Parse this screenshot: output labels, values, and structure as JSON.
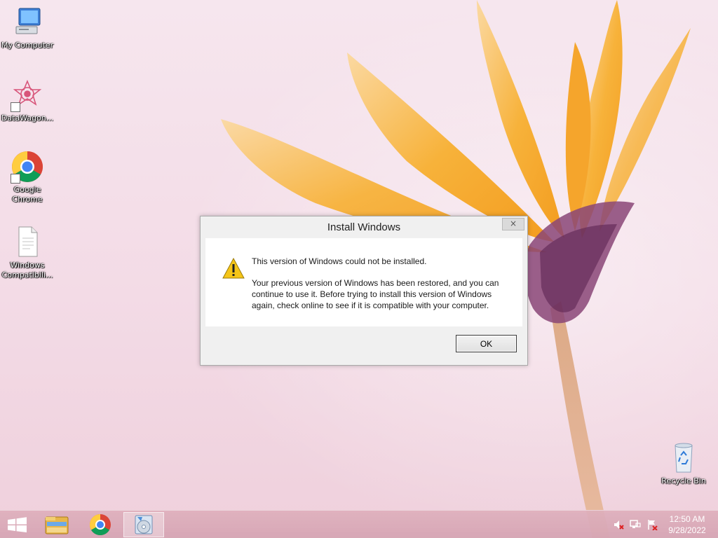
{
  "desktop": {
    "icons": [
      {
        "label": "My Computer",
        "icon": "computer-icon"
      },
      {
        "label": "DataWagon...",
        "icon": "datawagon-icon"
      },
      {
        "label": "Google Chrome",
        "icon": "chrome-icon"
      },
      {
        "label": "Windows Compatibili...",
        "icon": "document-icon"
      },
      {
        "label": "Recycle Bin",
        "icon": "recycle-bin-icon"
      }
    ]
  },
  "dialog": {
    "title": "Install Windows",
    "close_label": "×",
    "message_main": "This version of Windows could not be installed.",
    "message_detail": "Your previous version of Windows has been restored, and you can continue to use it.  Before trying to install this version of Windows again, check online to see if it is compatible with your computer.",
    "icon": "warning-icon",
    "ok_label": "OK"
  },
  "taskbar": {
    "buttons": [
      {
        "icon": "start-windows-icon"
      },
      {
        "icon": "file-explorer-icon"
      },
      {
        "icon": "chrome-icon"
      },
      {
        "icon": "setup-disc-icon",
        "active": true
      }
    ],
    "tray": [
      {
        "icon": "volume-muted-icon"
      },
      {
        "icon": "network-icon"
      },
      {
        "icon": "action-center-flag-icon"
      }
    ],
    "clock": {
      "time": "12:50 AM",
      "date": "9/28/2022"
    }
  },
  "colors": {
    "wallpaper_bg": "#f3dbe6",
    "flower_petal": "#f7b23a",
    "flower_center": "#7a3a6a",
    "dialog_bg": "#f0f0f0",
    "taskbar_bg": "#d9a7b6"
  }
}
